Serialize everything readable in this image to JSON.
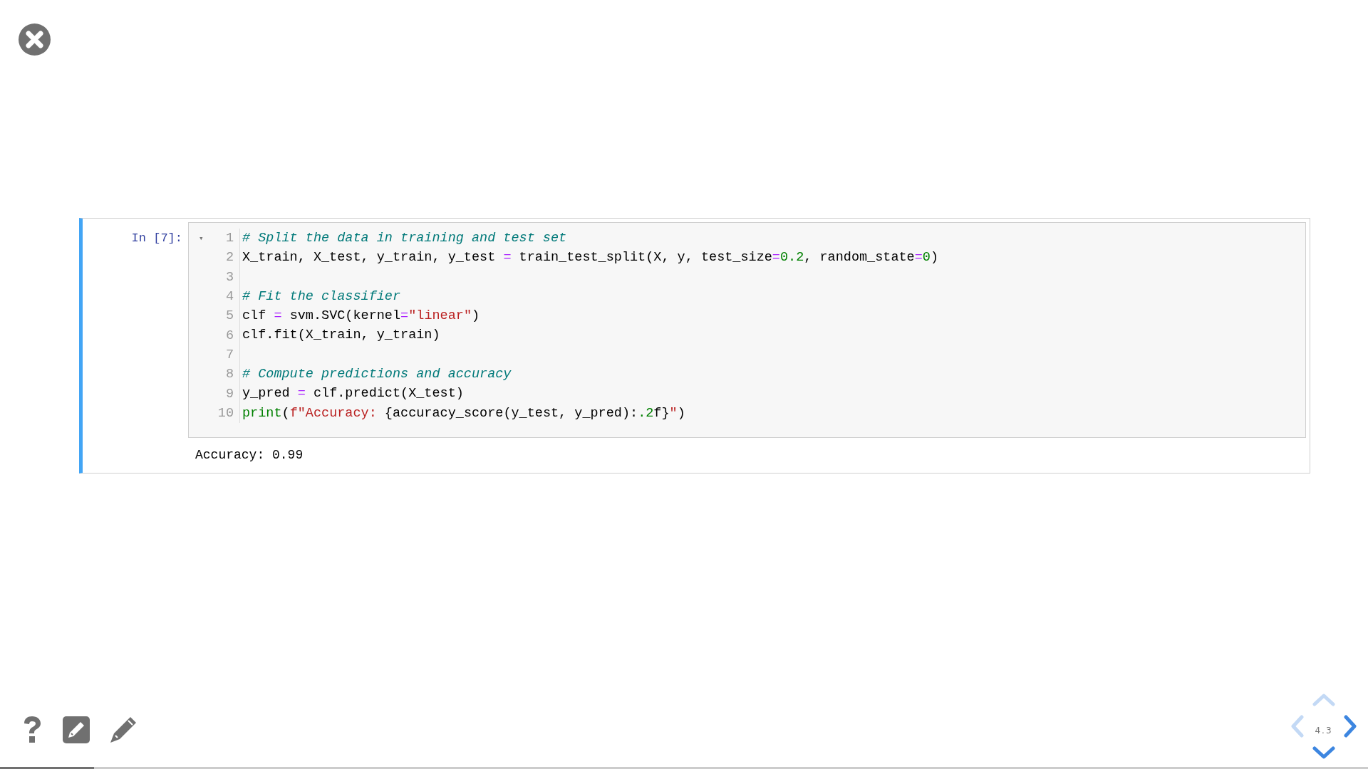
{
  "cell": {
    "prompt": "In [7]:",
    "fold_marker": "▾",
    "lines": [
      {
        "number": "1",
        "tokens": [
          {
            "kind": "comment",
            "text": "# Split the data in training and test set"
          }
        ]
      },
      {
        "number": "2",
        "tokens": [
          {
            "kind": "plain",
            "text": "X_train, X_test, y_train, y_test "
          },
          {
            "kind": "operator",
            "text": "="
          },
          {
            "kind": "plain",
            "text": " train_test_split(X, y, test_size"
          },
          {
            "kind": "operator",
            "text": "="
          },
          {
            "kind": "number",
            "text": "0.2"
          },
          {
            "kind": "plain",
            "text": ", random_state"
          },
          {
            "kind": "operator",
            "text": "="
          },
          {
            "kind": "number",
            "text": "0"
          },
          {
            "kind": "plain",
            "text": ")"
          }
        ]
      },
      {
        "number": "3"
      },
      {
        "number": "4",
        "tokens": [
          {
            "kind": "comment",
            "text": "# Fit the classifier"
          }
        ]
      },
      {
        "number": "5",
        "tokens": [
          {
            "kind": "plain",
            "text": "clf "
          },
          {
            "kind": "operator",
            "text": "="
          },
          {
            "kind": "plain",
            "text": " svm.SVC(kernel"
          },
          {
            "kind": "operator",
            "text": "="
          },
          {
            "kind": "string",
            "text": "\"linear\""
          },
          {
            "kind": "plain",
            "text": ")"
          }
        ]
      },
      {
        "number": "6",
        "tokens": [
          {
            "kind": "plain",
            "text": "clf.fit(X_train, y_train)"
          }
        ]
      },
      {
        "number": "7"
      },
      {
        "number": "8",
        "tokens": [
          {
            "kind": "comment",
            "text": "# Compute predictions and accuracy"
          }
        ]
      },
      {
        "number": "9",
        "tokens": [
          {
            "kind": "plain",
            "text": "y_pred "
          },
          {
            "kind": "operator",
            "text": "="
          },
          {
            "kind": "plain",
            "text": " clf.predict(X_test)"
          }
        ]
      },
      {
        "number": "10",
        "tokens": [
          {
            "kind": "builtin",
            "text": "print"
          },
          {
            "kind": "plain",
            "text": "("
          },
          {
            "kind": "string",
            "text": "f\"Accuracy: "
          },
          {
            "kind": "plain",
            "text": "{accuracy_score(y_test, y_pred):"
          },
          {
            "kind": "number",
            "text": ".2"
          },
          {
            "kind": "plain",
            "text": "f}"
          },
          {
            "kind": "string",
            "text": "\""
          },
          {
            "kind": "plain",
            "text": ")"
          }
        ]
      }
    ],
    "output": "Accuracy: 0.99"
  },
  "navigation": {
    "slide_number": "4.3",
    "arrows": [
      {
        "kind": "up",
        "enabled": false
      },
      {
        "kind": "left",
        "enabled": false
      },
      {
        "kind": "right",
        "enabled": true
      },
      {
        "kind": "down",
        "enabled": true
      }
    ]
  },
  "progress": {
    "level": 0.069
  }
}
